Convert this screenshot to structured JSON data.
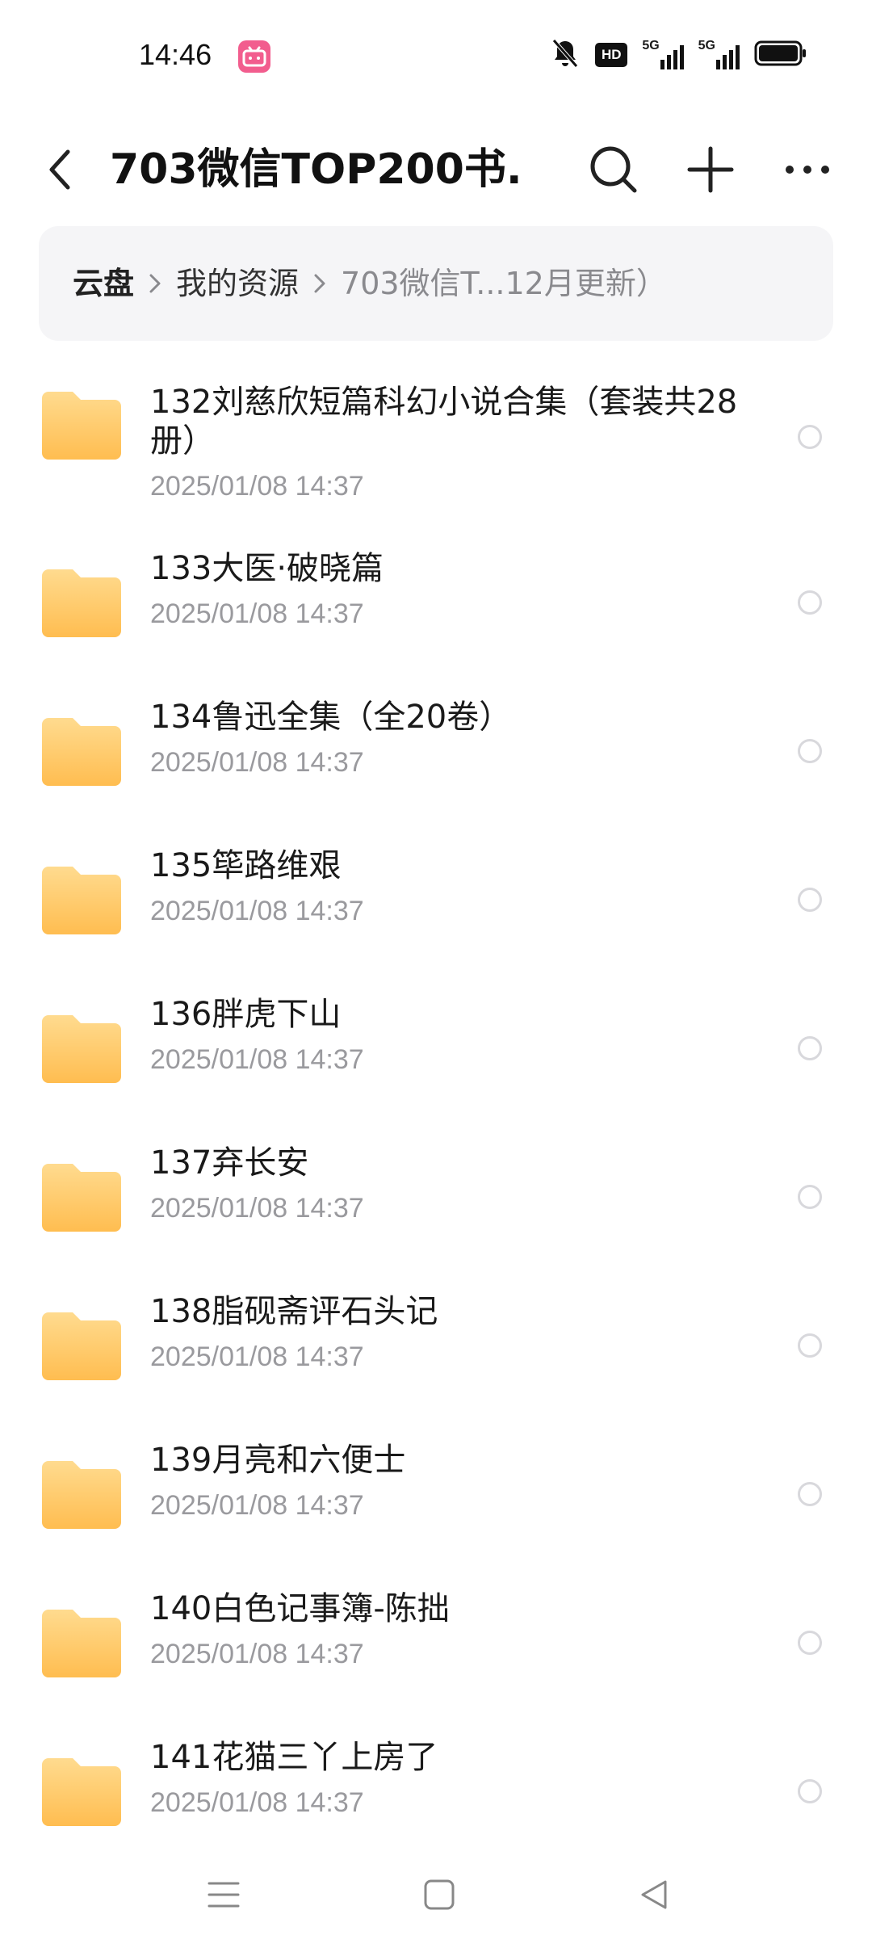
{
  "status_bar": {
    "time": "14:46",
    "icons": [
      "bilibili-app-icon",
      "mute-bell-icon",
      "hd-icon",
      "signal-5g-1-icon",
      "signal-5g-2-icon",
      "battery-icon"
    ],
    "hd_label": "HD",
    "net1_label": "5G",
    "net2_label": "5G"
  },
  "app_bar": {
    "title": "703微信TOP200书...",
    "back_icon": "chevron-left-icon",
    "search_icon": "search-icon",
    "add_icon": "plus-icon",
    "more_icon": "more-horizontal-icon"
  },
  "breadcrumb": {
    "root": "云盘",
    "mid": "我的资源",
    "current": "703微信T...12月更新）"
  },
  "files": [
    {
      "name": "132刘慈欣短篇科幻小说合集（套装共28册）",
      "date": "2025/01/08 14:37"
    },
    {
      "name": "133大医·破晓篇",
      "date": "2025/01/08 14:37"
    },
    {
      "name": "134鲁迅全集（全20卷）",
      "date": "2025/01/08 14:37"
    },
    {
      "name": "135筚路维艰",
      "date": "2025/01/08 14:37"
    },
    {
      "name": "136胖虎下山",
      "date": "2025/01/08 14:37"
    },
    {
      "name": "137弃长安",
      "date": "2025/01/08 14:37"
    },
    {
      "name": "138脂砚斋评石头记",
      "date": "2025/01/08 14:37"
    },
    {
      "name": "139月亮和六便士",
      "date": "2025/01/08 14:37"
    },
    {
      "name": "140白色记事簿-陈拙",
      "date": "2025/01/08 14:37"
    },
    {
      "name": "141花猫三丫上房了",
      "date": "2025/01/08 14:37"
    }
  ],
  "colors": {
    "folder_top": "#ffd98a",
    "folder_bottom": "#ffbf52",
    "date_gray": "#9a9a9e",
    "breadcrumb_bg": "#f5f5f7"
  },
  "nav_bar": {
    "icons": [
      "menu-icon",
      "home-square-icon",
      "back-triangle-icon"
    ]
  }
}
